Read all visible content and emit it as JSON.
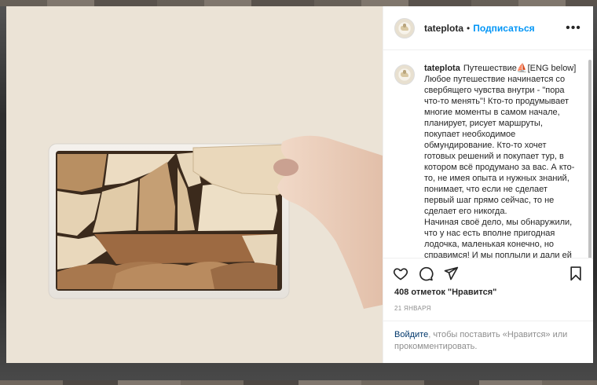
{
  "post": {
    "username": "tateplota",
    "separator": "•",
    "follow_label": "Подписаться",
    "more_icon": "more-icon",
    "caption_user": "tateplota",
    "caption_text": "Путешествие⛵️[ENG below]\nЛюбое путешествие начинается со свербящего чувства внутри - \"пора что-то менять\"! Кто-то продумывает многие моменты в самом начале, планирует, рисует маршруты, покупает необходимое обмундирование. Кто-то хочет готовых решений и покупает тур, в котором всё продумано за вас. А кто-то, не имея опыта и нужных знаний, понимает, что если не сделает первый шаг прямо сейчас, то не сделает его никогда.\nНачиная своё дело, мы обнаружили, что у нас есть вполне пригодная лодочка, маленькая конечно, но справимся! И мы поплыли и дали ей название",
    "likes": "408 отметок \"Нравится\"",
    "date": "21 ЯНВАРЯ",
    "login_link": "Войдите",
    "login_rest": ", чтобы поставить «Нравится» или прокомментировать."
  },
  "icons": {
    "like": "heart-icon",
    "comment": "comment-icon",
    "share": "share-icon",
    "save": "bookmark-icon"
  },
  "colors": {
    "accent": "#0095f6",
    "text": "#262626",
    "muted": "#8e8e8e",
    "link": "#00376b"
  }
}
